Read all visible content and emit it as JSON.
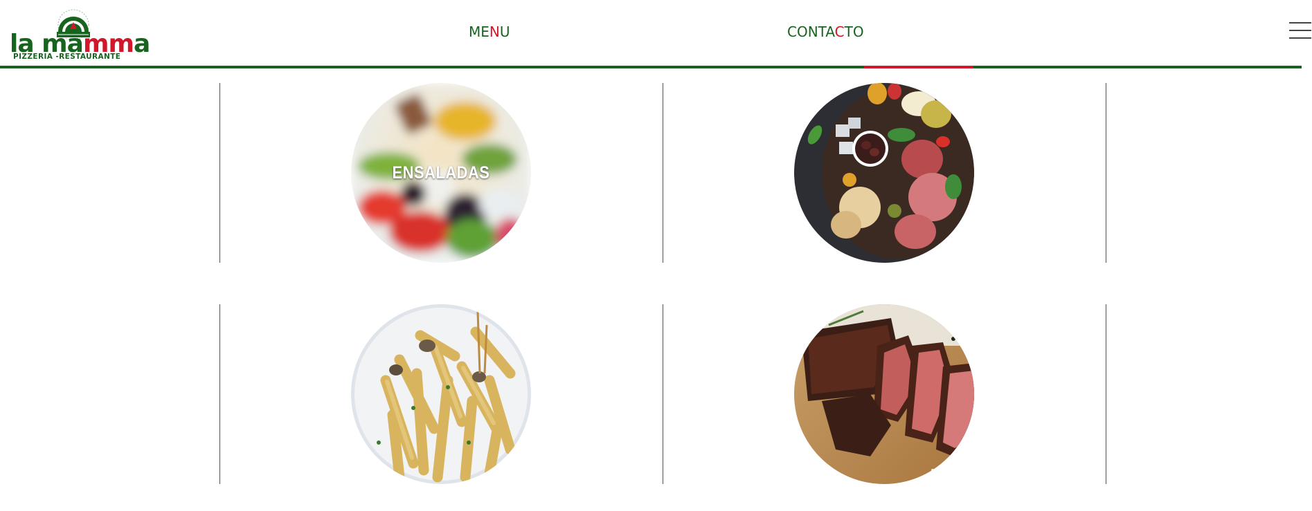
{
  "brand": {
    "name_part1": "la ma",
    "name_part2": "mm",
    "name_part3": "a",
    "tagline": "PIZZERIA -RESTAURANTE"
  },
  "nav": {
    "menu": {
      "p1": "ME",
      "p2": "N",
      "p3": "U"
    },
    "contact": {
      "p1": "CONTA",
      "p2": "C",
      "p3": "TO"
    }
  },
  "categories": [
    {
      "label": "ENSALADAS",
      "image": "salad"
    },
    {
      "label": "",
      "image": "antipasto-board"
    },
    {
      "label": "",
      "image": "pasta"
    },
    {
      "label": "",
      "image": "steak"
    }
  ],
  "colors": {
    "brand_green": "#17641e",
    "brand_red": "#d1172a",
    "divider_red": "#d1172a"
  },
  "icons": {
    "menu": "hamburger-icon"
  }
}
